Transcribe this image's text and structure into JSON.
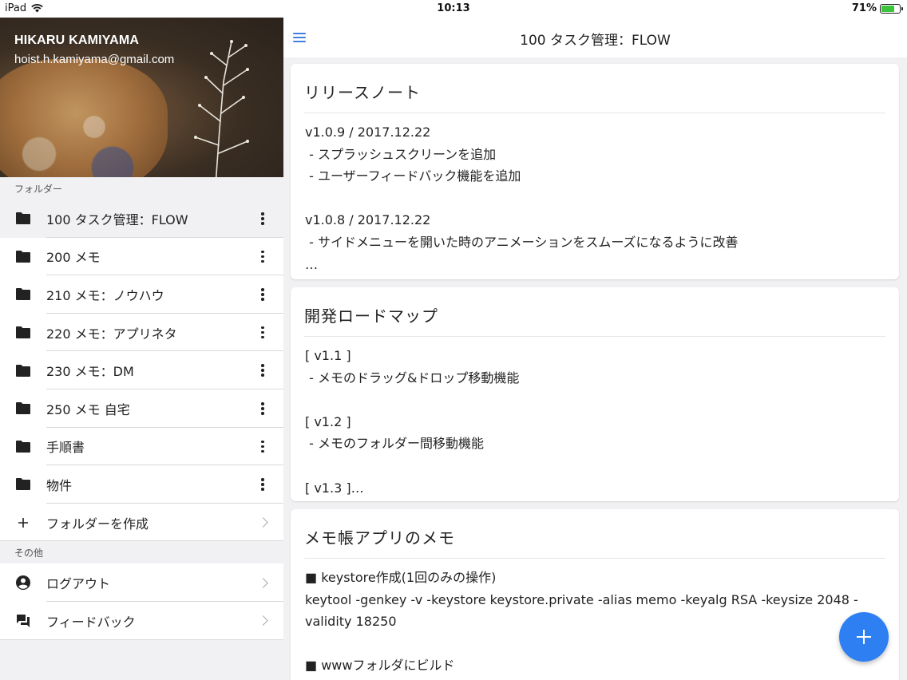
{
  "status_bar": {
    "device": "iPad",
    "time": "10:13",
    "battery_percent": "71%",
    "battery_level": 0.71
  },
  "profile": {
    "name": "HIKARU KAMIYAMA",
    "email": "hoist.h.kamiyama@gmail.com"
  },
  "folders": {
    "section_label": "フォルダー",
    "items": [
      {
        "label": "100 タスク管理：FLOW",
        "icon": "folder-icon",
        "active": true
      },
      {
        "label": "200 メモ",
        "icon": "folder-icon"
      },
      {
        "label": "210 メモ：ノウハウ",
        "icon": "folder-icon"
      },
      {
        "label": "220 メモ：アプリネタ",
        "icon": "folder-icon"
      },
      {
        "label": "230 メモ：DM",
        "icon": "folder-icon"
      },
      {
        "label": "250 メモ 自宅",
        "icon": "folder-icon"
      },
      {
        "label": "手順書",
        "icon": "folder-icon"
      },
      {
        "label": "物件",
        "icon": "folder-icon"
      }
    ],
    "create_label": "フォルダーを作成"
  },
  "others": {
    "section_label": "その他",
    "items": [
      {
        "label": "ログアウト",
        "icon": "account-circle-icon"
      },
      {
        "label": "フィードバック",
        "icon": "feedback-icon"
      }
    ]
  },
  "topbar": {
    "title": "100 タスク管理：FLOW"
  },
  "memos": [
    {
      "title": "リリースノート",
      "body": "v1.0.9 / 2017.12.22\n - スプラッシュスクリーンを追加\n - ユーザーフィードバック機能を追加\n\nv1.0.8 / 2017.12.22\n - サイドメニューを開いた時のアニメーションをスムーズになるように改善\n…"
    },
    {
      "title": "開発ロードマップ",
      "body": "[ v1.1 ]\n - メモのドラッグ&ドロップ移動機能\n\n[ v1.2 ]\n - メモのフォルダー間移動機能\n\n[ v1.3 ]…"
    },
    {
      "title": "メモ帳アプリのメモ",
      "body": "■ keystore作成(1回のみの操作)\nkeytool -genkey -v -keystore keystore.private -alias memo -keyalg RSA -keysize 2048 -validity 18250\n\n■ wwwフォルダにビルド\nnpm run release"
    }
  ],
  "colors": {
    "accent": "#2d7ff2",
    "menu_icon": "#3f7fe0"
  }
}
